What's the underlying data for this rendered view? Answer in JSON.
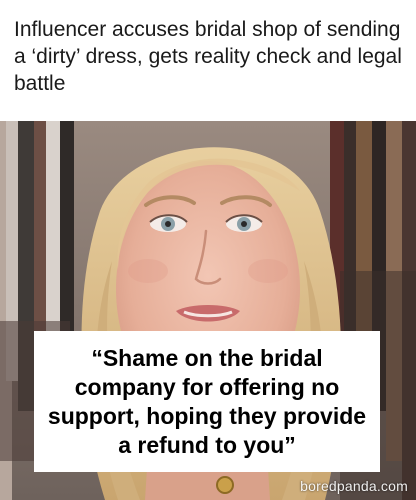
{
  "headline": "Influencer accuses bridal shop of sending a ‘dirty’ dress, gets reality check and legal battle",
  "quote": "“Shame on the bridal company for offering no support, hoping they provide a refund to you”",
  "watermark": "boredpanda.com",
  "colors": {
    "background": "#ffffff",
    "quote_box": "#ffffff",
    "quote_text": "#000000",
    "hair": "#d9b98a",
    "skin": "#e9b7a3",
    "closet_dark": "#3b2e2a"
  }
}
